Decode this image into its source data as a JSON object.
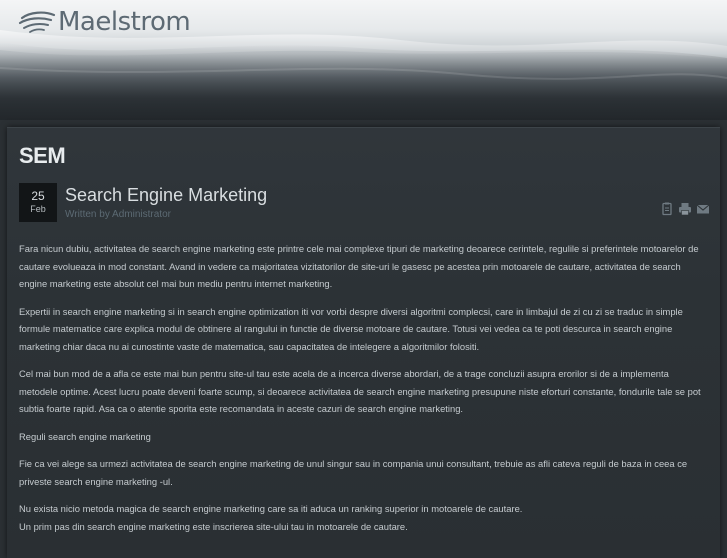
{
  "site": {
    "brand": "Maelstrom"
  },
  "page": {
    "title": "SEM"
  },
  "article": {
    "date_day": "25",
    "date_month": "Feb",
    "title": "Search Engine Marketing",
    "meta": "Written by Administrator",
    "tools": [
      "pdf-icon",
      "print-icon",
      "email-icon"
    ],
    "paragraphs": [
      "Fara nicun dubiu, activitatea de search engine marketing este printre cele mai complexe tipuri de marketing deoarece cerintele, regulile si preferintele motoarelor de cautare evolueaza in mod constant. Avand in vedere ca majoritatea vizitatorilor de site-uri le gasesc pe acestea prin motoarele de cautare, activitatea de search engine marketing este absolut cel mai bun mediu pentru internet marketing.",
      "Expertii in search engine marketing si in search engine optimization iti vor vorbi despre diversi algoritmi complecsi, care in limbajul de zi cu zi se traduc in simple formule matematice care explica modul de obtinere al rangului in functie de diverse motoare de cautare. Totusi vei vedea ca te poti descurca in search engine marketing chiar daca nu ai cunostinte vaste de matematica, sau capacitatea de intelegere a algoritmilor folositi.",
      "Cel mai bun mod de a afla ce este mai bun pentru site-ul tau este acela de a incerca diverse abordari, de a trage concluzii asupra erorilor si de a implementa metodele optime. Acest lucru poate deveni foarte scump, si deoarece activitatea de search engine marketing presupune niste eforturi constante, fondurile tale se pot subtia foarte rapid. Asa ca o atentie sporita este recomandata in aceste cazuri de search engine marketing.",
      "Reguli search engine marketing",
      "Fie ca vei alege sa urmezi activitatea de search engine marketing de unul singur sau in compania unui consultant, trebuie as afli cateva reguli de baza in ceea ce priveste search engine marketing -ul.",
      "Nu exista nicio metoda magica de search engine marketing care sa iti aduca un ranking superior in motoarele de cautare.",
      "Un prim pas din search engine marketing este inscrierea site-ului tau in motoarele de cautare."
    ]
  }
}
